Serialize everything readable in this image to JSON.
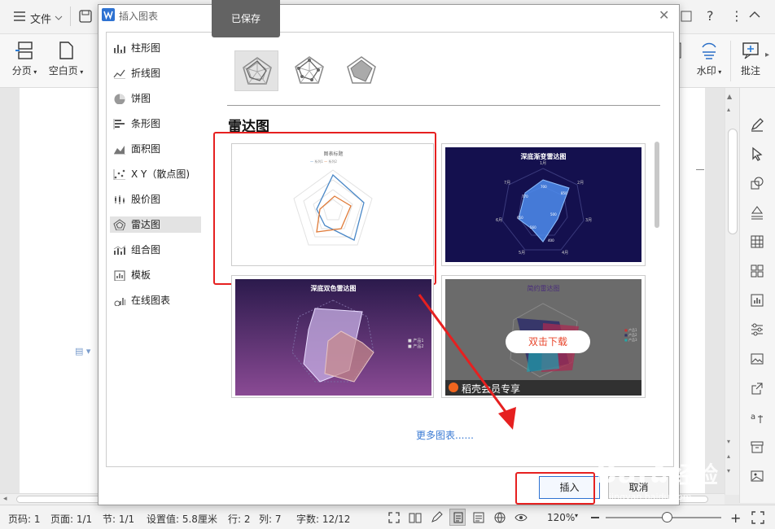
{
  "app": {
    "menu_file": "文件",
    "saved_tooltip": "已保存"
  },
  "ribbon": {
    "fenye": "分页",
    "kongbaiye": "空白页",
    "shuiyin": "水印",
    "pizhu": "批注"
  },
  "dialog": {
    "title": "插入图表",
    "categories": [
      {
        "label": "柱形图",
        "icon": "bar-chart-icon"
      },
      {
        "label": "折线图",
        "icon": "line-chart-icon"
      },
      {
        "label": "饼图",
        "icon": "pie-chart-icon"
      },
      {
        "label": "条形图",
        "icon": "hbar-chart-icon"
      },
      {
        "label": "面积图",
        "icon": "area-chart-icon"
      },
      {
        "label": "X Y（散点图)",
        "icon": "scatter-chart-icon"
      },
      {
        "label": "股价图",
        "icon": "stock-chart-icon"
      },
      {
        "label": "雷达图",
        "icon": "radar-chart-icon"
      },
      {
        "label": "组合图",
        "icon": "combo-chart-icon"
      },
      {
        "label": "模板",
        "icon": "template-icon"
      },
      {
        "label": "在线图表",
        "icon": "online-chart-icon"
      }
    ],
    "section_title": "雷达图",
    "thumb1_title": "图表标题",
    "thumb1_legend": [
      "系列1",
      "系列2"
    ],
    "thumb2_title": "深底渐变雷达图",
    "thumb2_axes": [
      "1月",
      "2月",
      "3月",
      "4月",
      "5月",
      "6月",
      "7月"
    ],
    "thumb2_values": [
      "700",
      "850",
      "500",
      "400",
      "560",
      "650",
      "770"
    ],
    "thumb3_title": "深底双色雷达图",
    "thumb3_legend": [
      "产品1",
      "产品2"
    ],
    "thumb4_title": "简约雷达图",
    "thumb4_legend": [
      "产品1",
      "产品2",
      "产品3"
    ],
    "download_label": "双击下载",
    "member_label": "稻壳会员专享",
    "more_link": "更多图表......",
    "insert_button": "插入",
    "cancel_button": "取消"
  },
  "status": {
    "page_no": "页码: 1",
    "page": "页面: 1/1",
    "section": "节: 1/1",
    "setting": "设置值: 5.8厘米",
    "row": "行: 2",
    "col": "列: 7",
    "words": "字数: 12/12",
    "zoom": "120%"
  },
  "watermark": {
    "brand": "Bai",
    "brand_cn": "经验",
    "url": "jingyan.baidu.com"
  },
  "colors": {
    "accent_red": "#e62020",
    "dark_navy": "#14104e",
    "purple_dark": "#2b1a4c",
    "link_blue": "#3b7bd4"
  }
}
